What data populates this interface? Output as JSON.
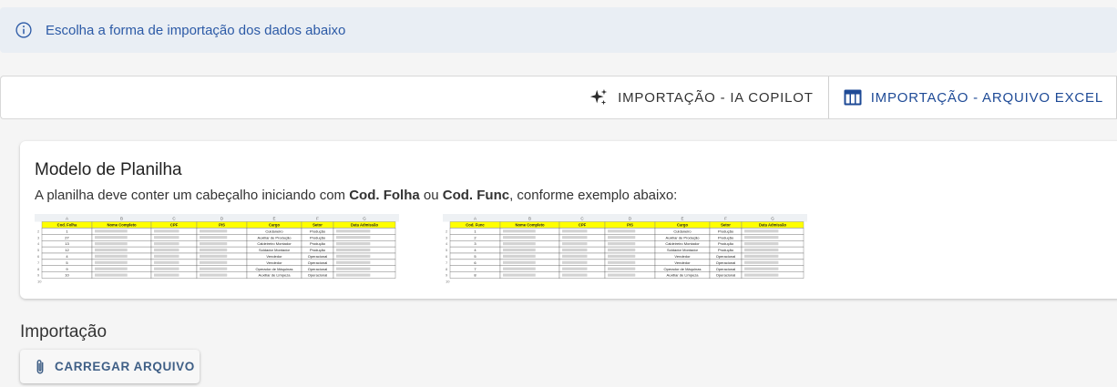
{
  "alert": {
    "icon": "info-icon",
    "message": "Escolha a forma de importação dos dados abaixo"
  },
  "tabs": [
    {
      "label": "IMPORTAÇÃO - IA COPILOT",
      "icon": "sparkles-icon",
      "active": false
    },
    {
      "label": "IMPORTAÇÃO - ARQUIVO EXCEL",
      "icon": "table-icon",
      "active": true
    }
  ],
  "model": {
    "title": "Modelo de Planilha",
    "desc_prefix": "A planilha deve conter um cabeçalho iniciando com ",
    "desc_key1": "Cod. Folha",
    "desc_mid": " ou ",
    "desc_key2": "Cod. Func",
    "desc_suffix": ", conforme exemplo abaixo:"
  },
  "example_sheets": [
    {
      "headers": [
        "Cod. Folha",
        "Nome Completo",
        "CPF",
        "PIS",
        "Cargo",
        "Setor",
        "Data Admissão"
      ],
      "rows": [
        [
          "1",
          "Cuidaneiro",
          "Produção"
        ],
        [
          "27",
          "Auxiliar de Produção",
          "Produção"
        ],
        [
          "13",
          "Caldeireiro Montador",
          "Produção"
        ],
        [
          "12",
          "Soldador Montador",
          "Produção"
        ],
        [
          "4",
          "Vendedor",
          "Operacional"
        ],
        [
          "5",
          "Vendedor",
          "Operacional"
        ],
        [
          "9",
          "Operador de Máquinas",
          "Operacional"
        ],
        [
          "10",
          "Auxiliar de Limpeza",
          "Operacional"
        ]
      ]
    },
    {
      "headers": [
        "Cod. Func",
        "Nome Completo",
        "CPF",
        "PIS",
        "Cargo",
        "Setor",
        "Data Admissão"
      ],
      "rows": [
        [
          "1",
          "Cuidaneiro",
          "Produção"
        ],
        [
          "2",
          "Auxiliar de Produção",
          "Produção"
        ],
        [
          "3",
          "Caldeireiro Montador",
          "Produção"
        ],
        [
          "4",
          "Soldador Montador",
          "Produção"
        ],
        [
          "5",
          "Vendedor",
          "Operacional"
        ],
        [
          "6",
          "Vendedor",
          "Operacional"
        ],
        [
          "7",
          "Operador de Máquinas",
          "Operacional"
        ],
        [
          "8",
          "Auxiliar de Limpeza",
          "Operacional"
        ]
      ]
    }
  ],
  "import_section": {
    "title": "Importação",
    "button_label": "CARREGAR ARQUIVO",
    "button_icon": "paperclip-icon"
  },
  "colors": {
    "accent": "#1e4a96",
    "alert_bg": "#e9eef4",
    "sheet_header": "#ffff00"
  }
}
